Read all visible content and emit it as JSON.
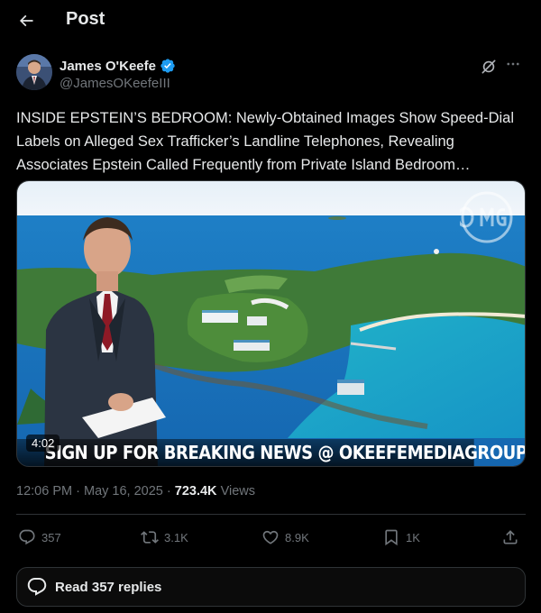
{
  "header": {
    "title": "Post",
    "back_icon": "arrow-left-icon"
  },
  "author": {
    "name": "James O'Keefe",
    "handle": "@JamesOKeefeIII",
    "verified": true,
    "verified_color": "#1d9bf0"
  },
  "post": {
    "text": "INSIDE EPSTEIN’S BEDROOM: Newly-Obtained Images Show Speed-Dial Labels on Alleged Sex Trafficker’s Landline Telephones, Revealing Associates Epstein Called Frequently from Private Island Bedroom…"
  },
  "media": {
    "duration": "4:02",
    "banner_text": "SIGN UP FOR BREAKING NEWS @ OKEEFEMEDIAGROUP.COM",
    "watermark": "OMG"
  },
  "meta": {
    "time": "12:06 PM",
    "separator": "·",
    "date": "May 16, 2025",
    "views_count": "723.4K",
    "views_label": "Views"
  },
  "actions": {
    "replies": "357",
    "reposts": "3.1K",
    "likes": "8.9K",
    "bookmarks": "1K"
  },
  "read_replies": {
    "label": "Read 357 replies"
  },
  "colors": {
    "background": "#000000",
    "text": "#e7e9ea",
    "muted": "#71767b",
    "border": "#2f3336",
    "accent": "#1d9bf0"
  }
}
